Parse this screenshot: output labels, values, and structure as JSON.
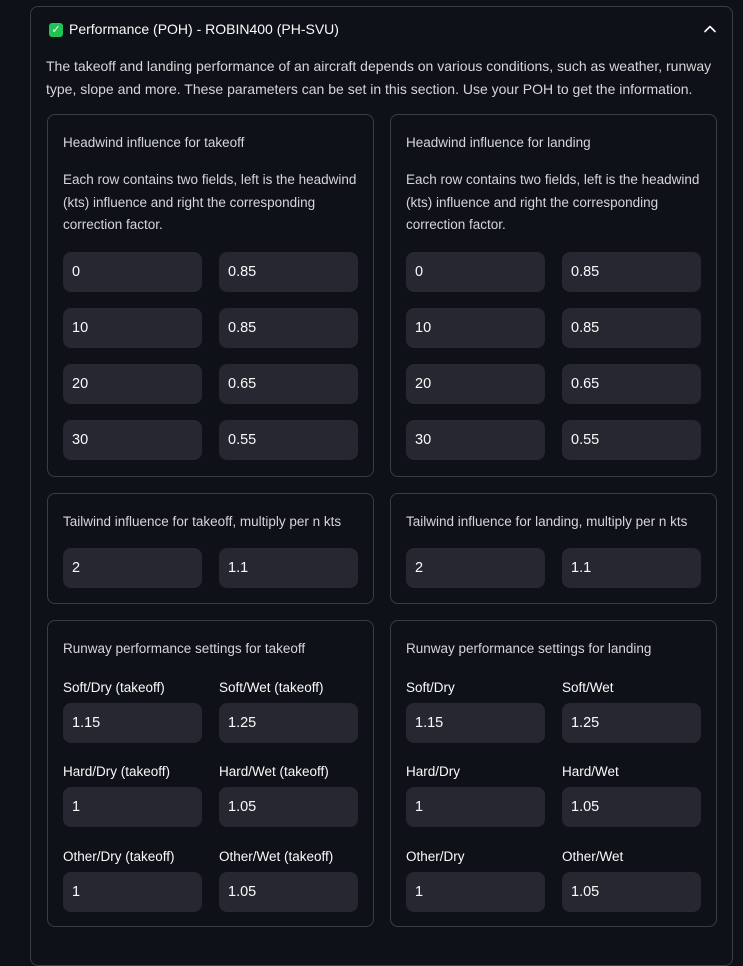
{
  "expander": {
    "title": "Performance (POH) - ROBIN400 (PH-SVU)",
    "checked": true,
    "check_color": "#21c354",
    "description": "The takeoff and landing performance of an aircraft depends on various conditions, such as weather, runway type, slope and more. These parameters can be set in this section. Use your POH to get the information."
  },
  "headwind": {
    "takeoff": {
      "title": "Headwind influence for takeoff",
      "description": "Each row contains two fields, left is the headwind (kts) influence and right the corresponding correction factor.",
      "rows": [
        {
          "kts": "0",
          "factor": "0.85"
        },
        {
          "kts": "10",
          "factor": "0.85"
        },
        {
          "kts": "20",
          "factor": "0.65"
        },
        {
          "kts": "30",
          "factor": "0.55"
        }
      ]
    },
    "landing": {
      "title": "Headwind influence for landing",
      "description": "Each row contains two fields, left is the headwind (kts) influence and right the corresponding correction factor.",
      "rows": [
        {
          "kts": "0",
          "factor": "0.85"
        },
        {
          "kts": "10",
          "factor": "0.85"
        },
        {
          "kts": "20",
          "factor": "0.65"
        },
        {
          "kts": "30",
          "factor": "0.55"
        }
      ]
    }
  },
  "tailwind": {
    "takeoff": {
      "title": "Tailwind influence for takeoff, multiply per n kts",
      "kts": "2",
      "factor": "1.1"
    },
    "landing": {
      "title": "Tailwind influence for landing, multiply per n kts",
      "kts": "2",
      "factor": "1.1"
    }
  },
  "runway": {
    "takeoff": {
      "title": "Runway performance settings for takeoff",
      "soft_dry": {
        "label": "Soft/Dry (takeoff)",
        "value": "1.15"
      },
      "soft_wet": {
        "label": "Soft/Wet (takeoff)",
        "value": "1.25"
      },
      "hard_dry": {
        "label": "Hard/Dry (takeoff)",
        "value": "1"
      },
      "hard_wet": {
        "label": "Hard/Wet (takeoff)",
        "value": "1.05"
      },
      "other_dry": {
        "label": "Other/Dry (takeoff)",
        "value": "1"
      },
      "other_wet": {
        "label": "Other/Wet (takeoff)",
        "value": "1.05"
      }
    },
    "landing": {
      "title": "Runway performance settings for landing",
      "soft_dry": {
        "label": "Soft/Dry",
        "value": "1.15"
      },
      "soft_wet": {
        "label": "Soft/Wet",
        "value": "1.25"
      },
      "hard_dry": {
        "label": "Hard/Dry",
        "value": "1"
      },
      "hard_wet": {
        "label": "Hard/Wet",
        "value": "1.05"
      },
      "other_dry": {
        "label": "Other/Dry",
        "value": "1"
      },
      "other_wet": {
        "label": "Other/Wet",
        "value": "1.05"
      }
    }
  }
}
